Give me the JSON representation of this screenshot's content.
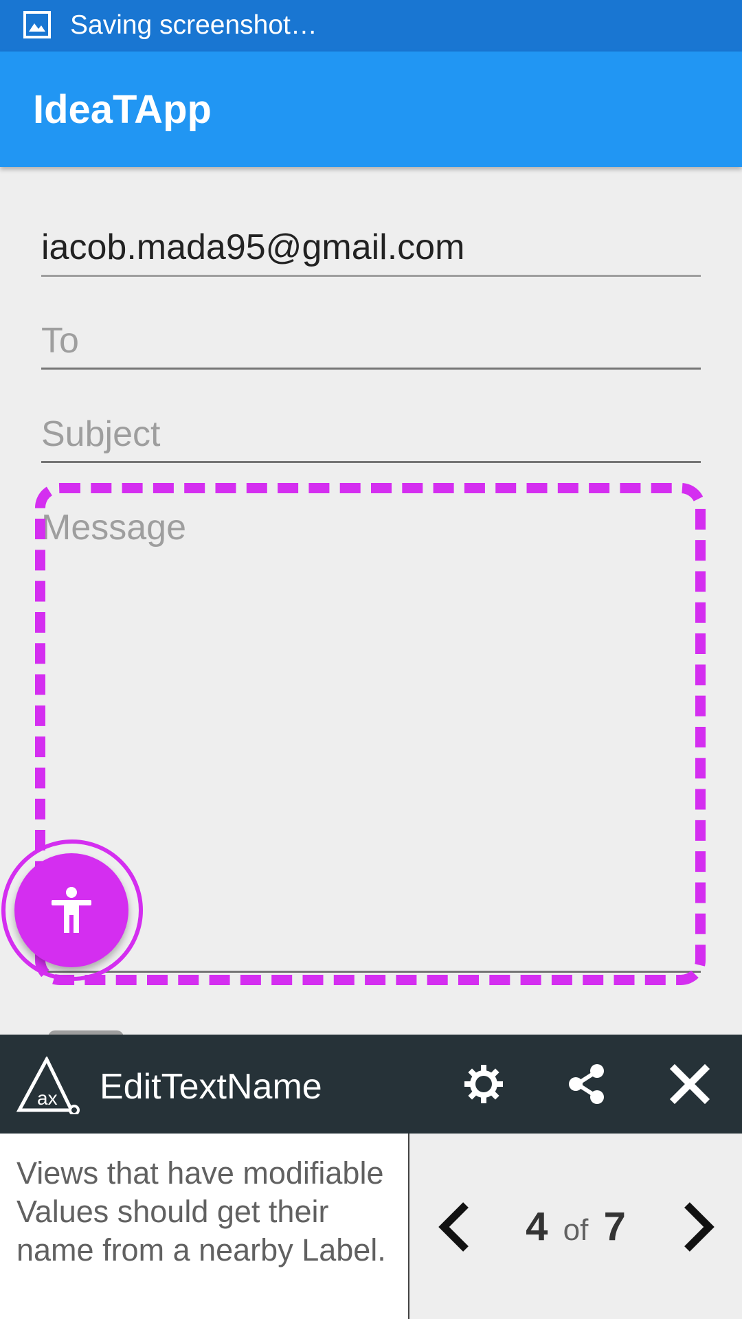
{
  "status_bar": {
    "text": "Saving screenshot…"
  },
  "app_bar": {
    "title": "IdeaTApp"
  },
  "form": {
    "from_value": "iacob.mada95@gmail.com",
    "to_placeholder": "To",
    "subject_placeholder": "Subject",
    "message_placeholder": "Message"
  },
  "scanner": {
    "title": "EditTextName",
    "description": "Views that have modifiable Values should get their name from a nearby Label.",
    "current": "4",
    "of_label": "of",
    "total": "7",
    "highlight_color": "#d42ef0"
  },
  "colors": {
    "status_bar": "#1976d2",
    "app_bar": "#2196f3",
    "toolbar": "#263238"
  },
  "icons": {
    "status": "image-icon",
    "fab": "accessibility-icon",
    "logo": "ax-logo",
    "settings": "gear-icon",
    "share": "share-icon",
    "close": "close-icon",
    "prev": "chevron-left-icon",
    "next": "chevron-right-icon"
  }
}
